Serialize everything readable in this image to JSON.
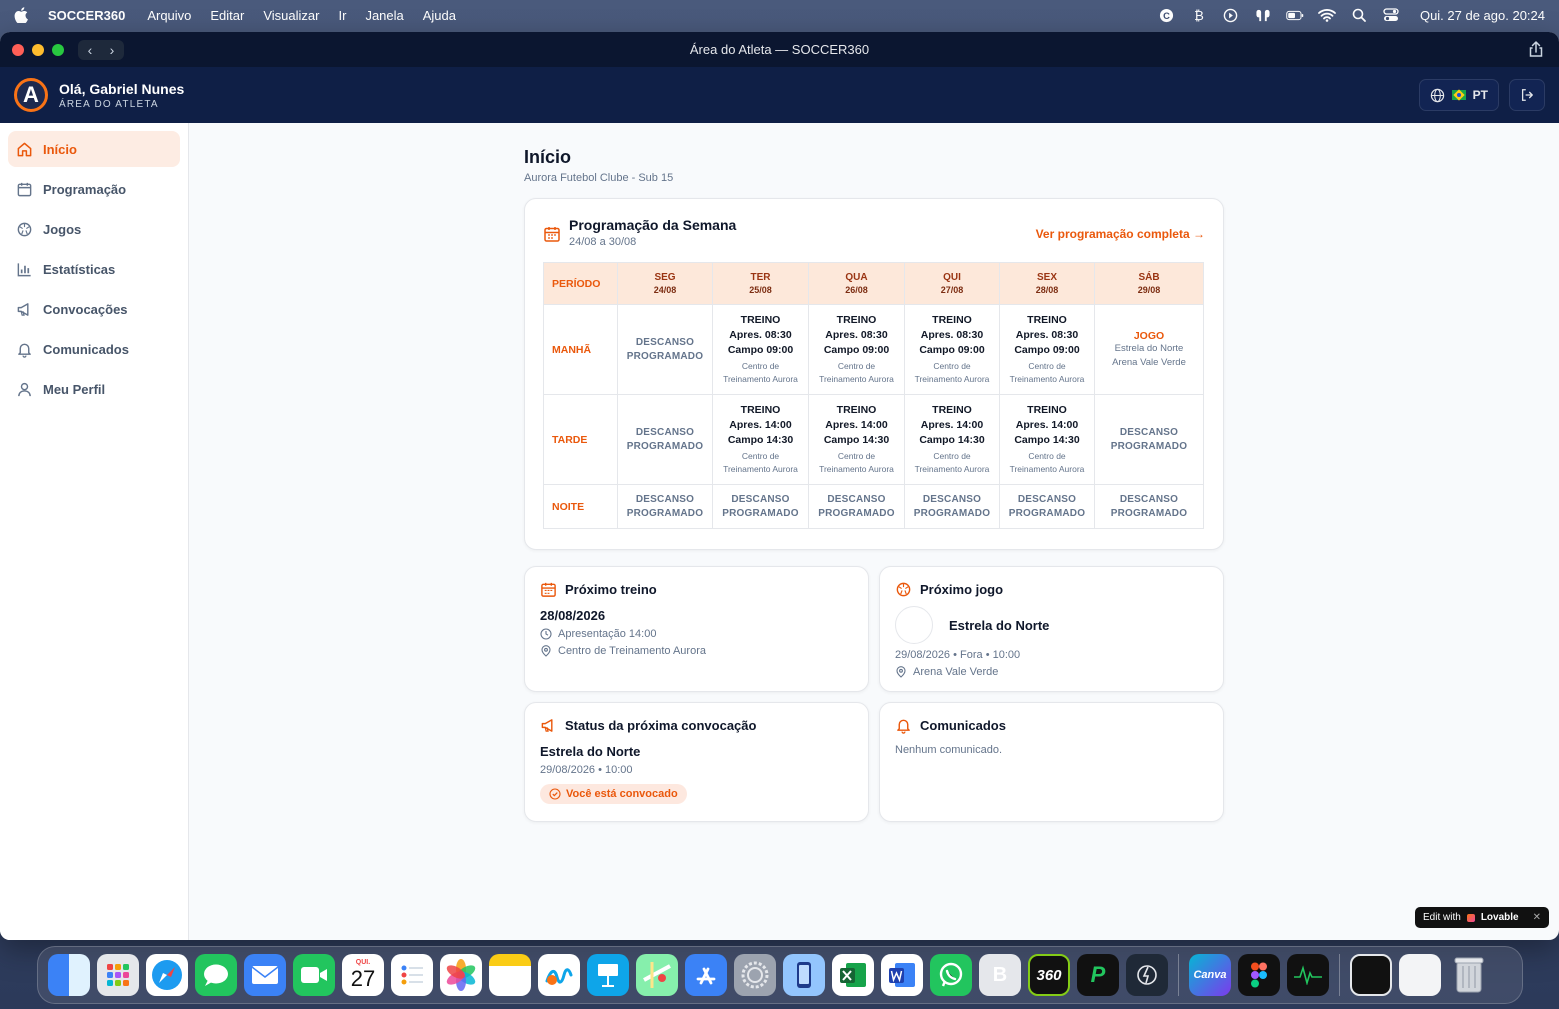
{
  "menubar": {
    "app_name": "SOCCER360",
    "menus": [
      "Arquivo",
      "Editar",
      "Visualizar",
      "Ir",
      "Janela",
      "Ajuda"
    ],
    "clock": "Qui. 27 de ago.  20:24"
  },
  "window": {
    "title": "Área do Atleta — SOCCER360"
  },
  "header": {
    "logo_letter": "A",
    "greeting": "Olá, Gabriel Nunes",
    "subtitle": "ÁREA DO ATLETA",
    "lang": "PT"
  },
  "sidebar": {
    "items": [
      {
        "label": "Início",
        "icon": "home-icon",
        "active": true
      },
      {
        "label": "Programação",
        "icon": "calendar-icon"
      },
      {
        "label": "Jogos",
        "icon": "ball-icon"
      },
      {
        "label": "Estatísticas",
        "icon": "bar-chart-icon"
      },
      {
        "label": "Convocações",
        "icon": "megaphone-icon"
      },
      {
        "label": "Comunicados",
        "icon": "bell-icon"
      },
      {
        "label": "Meu Perfil",
        "icon": "user-icon"
      }
    ]
  },
  "page": {
    "title": "Início",
    "subtitle": "Aurora Futebol Clube - Sub 15"
  },
  "week": {
    "title": "Programação da Semana",
    "range": "24/08 a 30/08",
    "full_link": "Ver programação completa →",
    "period_header": "PERÍODO",
    "days": [
      {
        "d": "SEG",
        "dt": "24/08"
      },
      {
        "d": "TER",
        "dt": "25/08"
      },
      {
        "d": "QUA",
        "dt": "26/08"
      },
      {
        "d": "QUI",
        "dt": "27/08"
      },
      {
        "d": "SEX",
        "dt": "28/08"
      },
      {
        "d": "SÁB",
        "dt": "29/08"
      }
    ],
    "periods": [
      "MANHÃ",
      "TARDE",
      "NOITE"
    ],
    "rest_l1": "DESCANSO",
    "rest_l2": "PROGRAMADO",
    "training_label": "TREINO",
    "morning_apres": "Apres. 08:30",
    "morning_campo": "Campo 09:00",
    "afternoon_apres": "Apres. 14:00",
    "afternoon_campo": "Campo 14:30",
    "loc_l1": "Centro de",
    "loc_l2": "Treinamento Aurora",
    "game_label": "JOGO",
    "game_opponent": "Estrela do Norte",
    "game_venue": "Arena Vale Verde"
  },
  "next_training": {
    "title": "Próximo treino",
    "date": "28/08/2026",
    "presentation": "Apresentação 14:00",
    "location": "Centro de Treinamento Aurora"
  },
  "next_game": {
    "title": "Próximo jogo",
    "opponent": "Estrela do Norte",
    "details": "29/08/2026 • Fora • 10:00",
    "venue": "Arena Vale Verde"
  },
  "callup": {
    "title": "Status da próxima convocação",
    "opponent": "Estrela do Norte",
    "when": "29/08/2026 • 10:00",
    "status": "Você está convocado"
  },
  "announcements": {
    "title": "Comunicados",
    "empty": "Nenhum comunicado."
  },
  "lovable": {
    "prefix": "Edit with",
    "brand": "Lovable",
    "close": "✕"
  },
  "dock": {
    "calendar_month": "QUI.",
    "calendar_day": "27",
    "canva": "Canva",
    "soccer360": "360"
  },
  "colors": {
    "accent": "#ea580c",
    "header_bg": "#0f1f46",
    "sidebar_active_bg": "#fdece3"
  }
}
